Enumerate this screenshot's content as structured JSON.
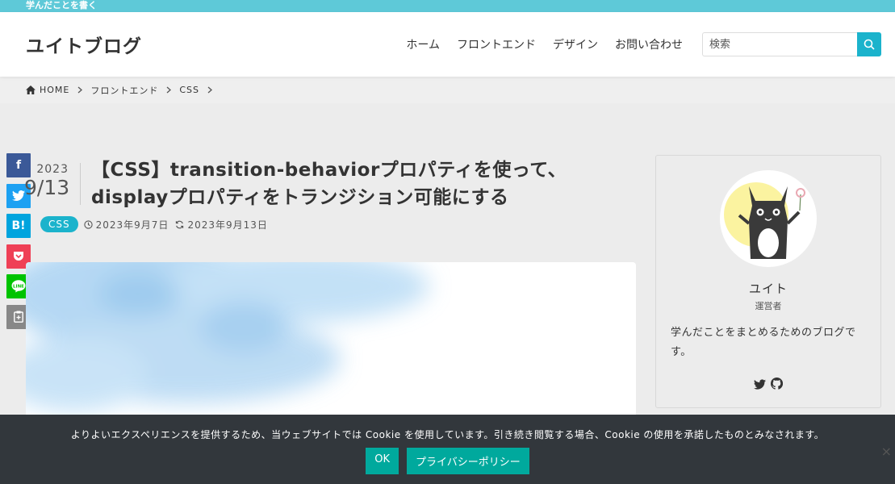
{
  "topbar": {
    "tagline": "学んだことを書く"
  },
  "header": {
    "logo": "ユイトブログ",
    "nav": [
      "ホーム",
      "フロントエンド",
      "デザイン",
      "お問い合わせ"
    ],
    "search_placeholder": "検索"
  },
  "breadcrumb": [
    "HOME",
    "フロントエンド",
    "CSS"
  ],
  "post": {
    "date_year": "2023",
    "date_md": "9/13",
    "title_line1": "【CSS】transition-behaviorプロパティを使って、",
    "title_line2": "displayプロパティをトランジション可能にする",
    "category": "CSS",
    "published": "2023年9月7日",
    "updated": "2023年9月13日"
  },
  "share": [
    {
      "name": "facebook",
      "label": "f",
      "color": "#3b5998"
    },
    {
      "name": "twitter",
      "label": "",
      "color": "#1da1f2"
    },
    {
      "name": "hatena",
      "label": "B!",
      "color": "#00a4de"
    },
    {
      "name": "pocket",
      "label": "",
      "color": "#ef4056"
    },
    {
      "name": "line",
      "label": "",
      "color": "#00c300"
    },
    {
      "name": "copy",
      "label": "",
      "color": "#888888"
    }
  ],
  "profile": {
    "name": "ユイト",
    "role": "運営者",
    "description": "学んだことをまとめるためのブログです。"
  },
  "cookie": {
    "message": "よりよいエクスペリエンスを提供するため、当ウェブサイトでは Cookie を使用しています。引き続き閲覧する場合、Cookie の使用を承諾したものとみなされます。",
    "ok_label": "OK",
    "policy_label": "プライバシーポリシー",
    "close": "×"
  },
  "colors": {
    "accent": "#1bb3cc",
    "topbar": "#5ec9d8",
    "cookie_bg": "#32373c",
    "cookie_btn": "#00a99d"
  }
}
